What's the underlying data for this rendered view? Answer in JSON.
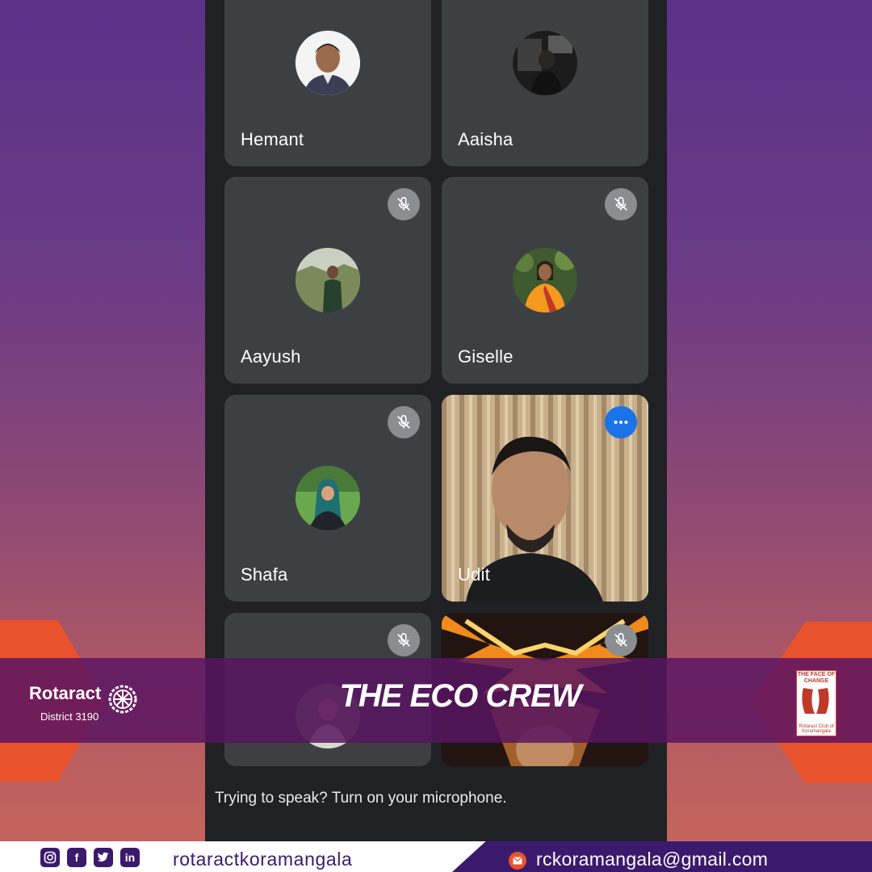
{
  "participants": [
    {
      "name": "Hemant"
    },
    {
      "name": "Aaisha"
    },
    {
      "name": "Aayush"
    },
    {
      "name": "Giselle"
    },
    {
      "name": "Shafa"
    },
    {
      "name": "Udit"
    }
  ],
  "hint_text": "Trying to speak? Turn on your microphone.",
  "banner": {
    "title": "THE ECO CREW"
  },
  "left_logo": {
    "name": "Rotaract",
    "district": "District 3190"
  },
  "right_logo": {
    "line1": "THE FACE OF CHANGE",
    "line2": "Rotaract Club of Koramangala"
  },
  "footer": {
    "social_icons": [
      "instagram-icon",
      "facebook-icon",
      "twitter-icon",
      "linkedin-icon"
    ],
    "handle": "rotaractkoramangala",
    "email": "rckoramangala@gmail.com"
  },
  "colors": {
    "meet_bg": "#202124",
    "tile_bg": "#3c4043",
    "accent_orange": "#e8522c",
    "brand_purple": "#3b1a6d",
    "more_button_blue": "#1a73e8"
  }
}
